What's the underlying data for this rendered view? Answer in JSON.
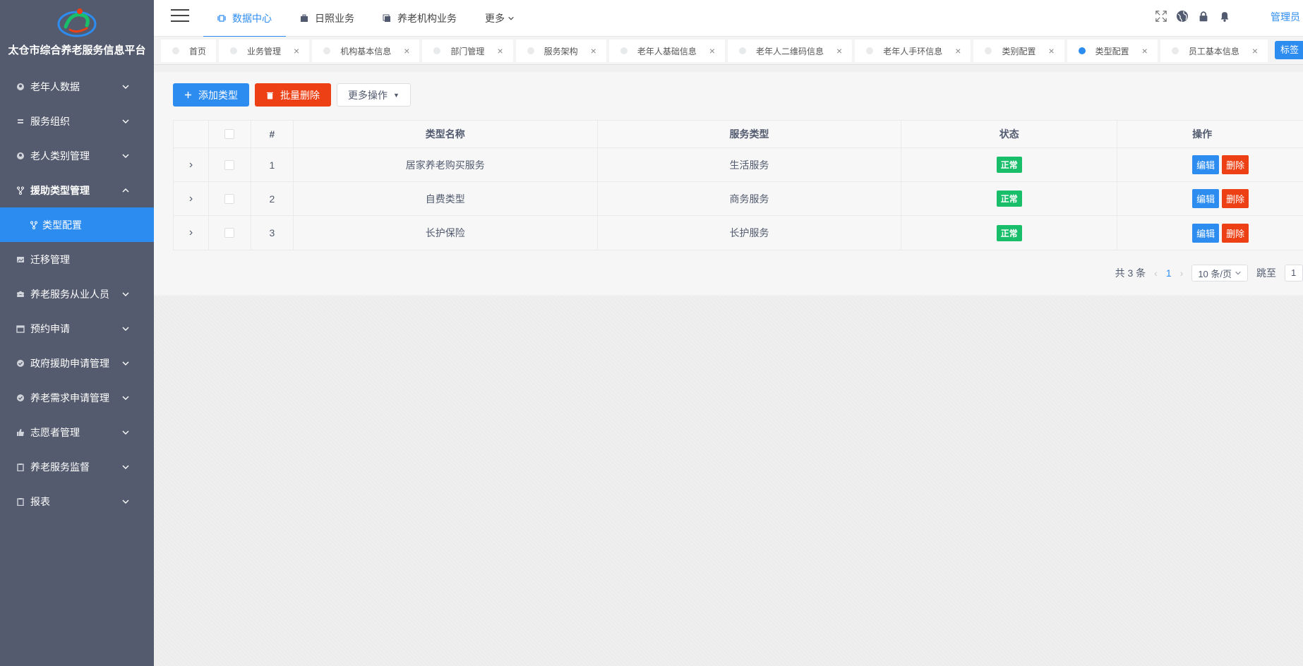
{
  "app": {
    "title": "太仓市综合养老服务信息平台"
  },
  "sidebar": {
    "items": [
      {
        "label": "老年人数据",
        "icon": "elder-icon"
      },
      {
        "label": "服务组织",
        "icon": "list-icon"
      },
      {
        "label": "老人类别管理",
        "icon": "elder-icon"
      },
      {
        "label": "援助类型管理",
        "icon": "branch-icon",
        "open": true
      },
      {
        "label": "迁移管理",
        "icon": "image-icon"
      },
      {
        "label": "养老服务从业人员",
        "icon": "group-icon"
      },
      {
        "label": "预约申请",
        "icon": "calendar-icon"
      },
      {
        "label": "政府援助申请管理",
        "icon": "check-circle-icon"
      },
      {
        "label": "养老需求申请管理",
        "icon": "check-circle-icon"
      },
      {
        "label": "志愿者管理",
        "icon": "thumb-up-icon"
      },
      {
        "label": "养老服务监督",
        "icon": "clipboard-icon"
      },
      {
        "label": "报表",
        "icon": "clipboard-icon"
      }
    ],
    "submenu": {
      "label": "类型配置",
      "icon": "branch-icon"
    }
  },
  "topnav": {
    "items": [
      {
        "label": "数据中心",
        "active": true
      },
      {
        "label": "日照业务"
      },
      {
        "label": "养老机构业务"
      },
      {
        "label": "更多"
      }
    ],
    "user": "管理员"
  },
  "tabs": [
    {
      "label": "首页",
      "closable": false
    },
    {
      "label": "业务管理",
      "closable": true
    },
    {
      "label": "机构基本信息",
      "closable": true
    },
    {
      "label": "部门管理",
      "closable": true
    },
    {
      "label": "服务架构",
      "closable": true
    },
    {
      "label": "老年人基础信息",
      "closable": true
    },
    {
      "label": "老年人二维码信息",
      "closable": true
    },
    {
      "label": "老年人手环信息",
      "closable": true
    },
    {
      "label": "类别配置",
      "closable": true
    },
    {
      "label": "类型配置",
      "closable": true,
      "active": true
    },
    {
      "label": "员工基本信息",
      "closable": true
    }
  ],
  "tab_more_label": "标签",
  "toolbar": {
    "add_label": "添加类型",
    "batch_delete_label": "批量删除",
    "more_label": "更多操作"
  },
  "table": {
    "headers": {
      "index": "#",
      "name": "类型名称",
      "service": "服务类型",
      "status": "状态",
      "ops": "操作"
    },
    "rows": [
      {
        "index": "1",
        "name": "居家养老购买服务",
        "service": "生活服务",
        "status": "正常"
      },
      {
        "index": "2",
        "name": "自费类型",
        "service": "商务服务",
        "status": "正常"
      },
      {
        "index": "3",
        "name": "长护保险",
        "service": "长护服务",
        "status": "正常"
      }
    ],
    "edit_label": "编辑",
    "delete_label": "删除"
  },
  "pager": {
    "total_text": "共 3 条",
    "current_page": "1",
    "page_size": "10 条/页",
    "jump_label": "跳至",
    "jump_value": "1"
  },
  "colors": {
    "sidebar_bg": "#545b6e",
    "primary": "#2d8cf0",
    "danger": "#ed4014",
    "success": "#19be6b"
  }
}
